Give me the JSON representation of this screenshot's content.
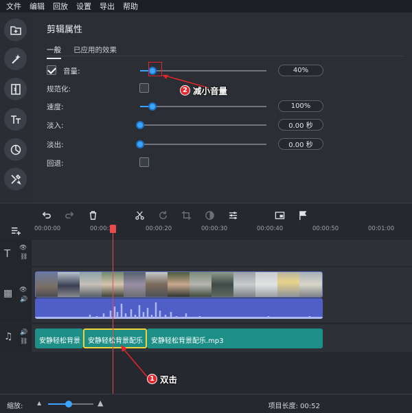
{
  "menu": {
    "items": [
      "文件",
      "编辑",
      "回放",
      "设置",
      "导出",
      "帮助"
    ]
  },
  "panel": {
    "title": "剪辑属性",
    "tabs": [
      "一般",
      "已应用的效果"
    ],
    "rows": {
      "volume": {
        "label": "音量:",
        "checked": true,
        "value_text": "40%",
        "value": 0.1
      },
      "normalize": {
        "label": "规范化:",
        "checked": false
      },
      "speed": {
        "label": "速度:",
        "value_text": "100%",
        "value": 0.1
      },
      "fade_in": {
        "label": "淡入:",
        "value_text": "0.00 秒",
        "value": 0.0
      },
      "fade_out": {
        "label": "淡出:",
        "value_text": "0.00 秒",
        "value": 0.0
      },
      "reverse": {
        "label": "回退:",
        "checked": false
      }
    }
  },
  "annotations": {
    "step1": {
      "num": "1",
      "text": "双击"
    },
    "step2": {
      "num": "2",
      "text": "减小音量"
    }
  },
  "timeline": {
    "ruler": [
      "00:00:00",
      "00:00:10",
      "00:00:20",
      "00:00:30",
      "00:00:40",
      "00:00:50",
      "00:01:00"
    ],
    "music_clips": [
      "安静轻松背景",
      "安静轻松背景配乐",
      "安静轻松背景配乐.mp3"
    ]
  },
  "footer": {
    "zoom_label": "缩放:",
    "duration_label": "项目长度:",
    "duration": "00:52",
    "zoom": 0.45
  },
  "colors": {
    "accent": "#3ba4ff",
    "annotation": "#e3262b",
    "music_clip": "#1e8f87",
    "video_clip": "#4f5fc7",
    "playhead": "#ea4a4a",
    "selection": "#f0d23a"
  }
}
